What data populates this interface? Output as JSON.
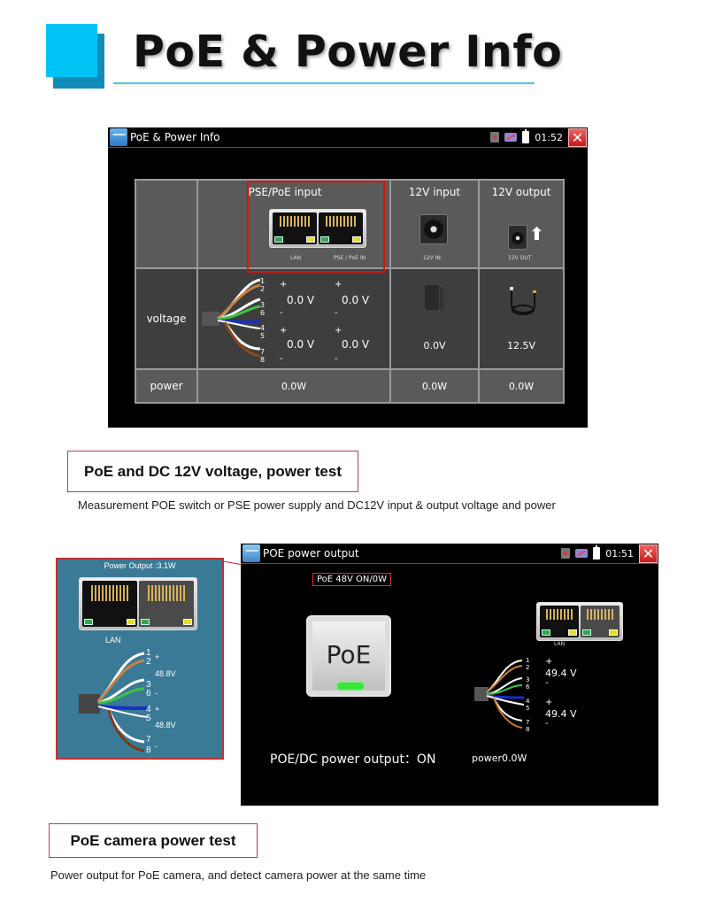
{
  "heading": {
    "title": "PoE & Power Info"
  },
  "screen1": {
    "titlebar": {
      "title": "PoE & Power Info",
      "time": "01:52",
      "icons": [
        "app-icon",
        "sd-card-icon",
        "network-icon",
        "battery-icon",
        "close-icon"
      ],
      "close_glyph": "✕"
    },
    "table": {
      "columns": {
        "pse": {
          "label": "PSE/PoE input",
          "port_labels": [
            "LAN",
            "PSE / PoE IN"
          ]
        },
        "in12": {
          "label": "12V input",
          "jack_label": "12V IN"
        },
        "out12": {
          "label": "12V output",
          "jack_label": "12V OUT",
          "arrow": "⬆"
        }
      },
      "rows": {
        "voltage": {
          "label": "voltage",
          "pins": [
            "1",
            "2",
            "3",
            "6",
            "4",
            "5",
            "7",
            "8"
          ],
          "pair_signs": [
            "+",
            "-",
            "+",
            "-"
          ],
          "pse_values": {
            "lan_top": "0.0 V",
            "poe_top": "0.0 V",
            "lan_bottom": "0.0 V",
            "poe_bottom": "0.0 V"
          },
          "in12": "0.0V",
          "out12": "12.5V"
        },
        "power": {
          "label": "power",
          "pse": "0.0W",
          "in12": "0.0W",
          "out12": "0.0W"
        }
      }
    }
  },
  "caption1": {
    "title": "PoE and DC 12V voltage, power test",
    "description": "Measurement POE switch or PSE power supply and DC12V input & output voltage and power"
  },
  "inset": {
    "title": "Power Output :3.1W",
    "port_label": "LAN",
    "pins": [
      "1",
      "2",
      "3",
      "6",
      "4",
      "5",
      "7",
      "8"
    ],
    "signs": [
      "+",
      "-",
      "+",
      "-"
    ],
    "voltages": [
      "48.8V",
      "48.8V"
    ]
  },
  "screen2": {
    "titlebar": {
      "title": "POE power output",
      "time": "01:51",
      "close_glyph": "✕"
    },
    "status_badge": "PoE 48V ON/0W",
    "poe_button": {
      "label": "PoE",
      "led_color": "#38e838"
    },
    "port_label": "LAN",
    "pins": [
      "1",
      "2",
      "3",
      "6",
      "4",
      "5",
      "7",
      "8"
    ],
    "signs": [
      "+",
      "-",
      "+",
      "-"
    ],
    "voltages": [
      "49.4 V",
      "49.4 V"
    ],
    "output_status": "POE/DC power output：ON",
    "power_reading": "power0.0W"
  },
  "caption2": {
    "title": "PoE camera power test",
    "description": "Power output for PoE camera, and detect camera power at the same time"
  },
  "colors": {
    "accent_cyan": "#00c3f5",
    "accent_dark": "#0f8db8",
    "highlight_red": "#d11111",
    "inset_blue": "#3a7a96"
  }
}
